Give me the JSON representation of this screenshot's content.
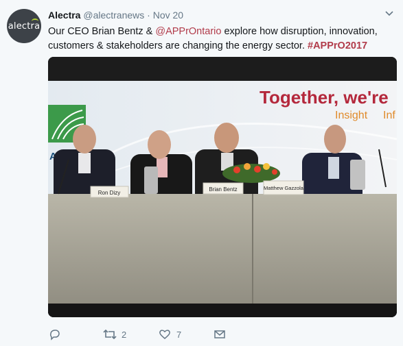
{
  "tweet": {
    "author_name": "Alectra",
    "author_handle": "@alectranews",
    "separator": "·",
    "time": "Nov 20",
    "avatar_text": "alectra",
    "text_part1": "Our CEO Brian Bentz & ",
    "mention": "@APPrOntario",
    "text_part2": " explore how disruption, innovation, customers & stakeholders are changing the energy sector. ",
    "hashtag": "#APPrO2017"
  },
  "photo": {
    "banner_title": "Together, we're",
    "banner_words": [
      "Insight",
      "Inf"
    ],
    "logo_text": "APP",
    "nameplates": [
      "Ron Dizy",
      "Brian Bentz",
      "Matthew Gazzola"
    ]
  },
  "actions": {
    "reply_count": "",
    "retweet_count": "2",
    "like_count": "7"
  },
  "colors": {
    "link": "#b13b4a",
    "muted": "#657786",
    "background": "#f5f8fa"
  },
  "icons": [
    "reply-icon",
    "retweet-icon",
    "like-icon",
    "message-icon",
    "chevron-down-icon"
  ]
}
